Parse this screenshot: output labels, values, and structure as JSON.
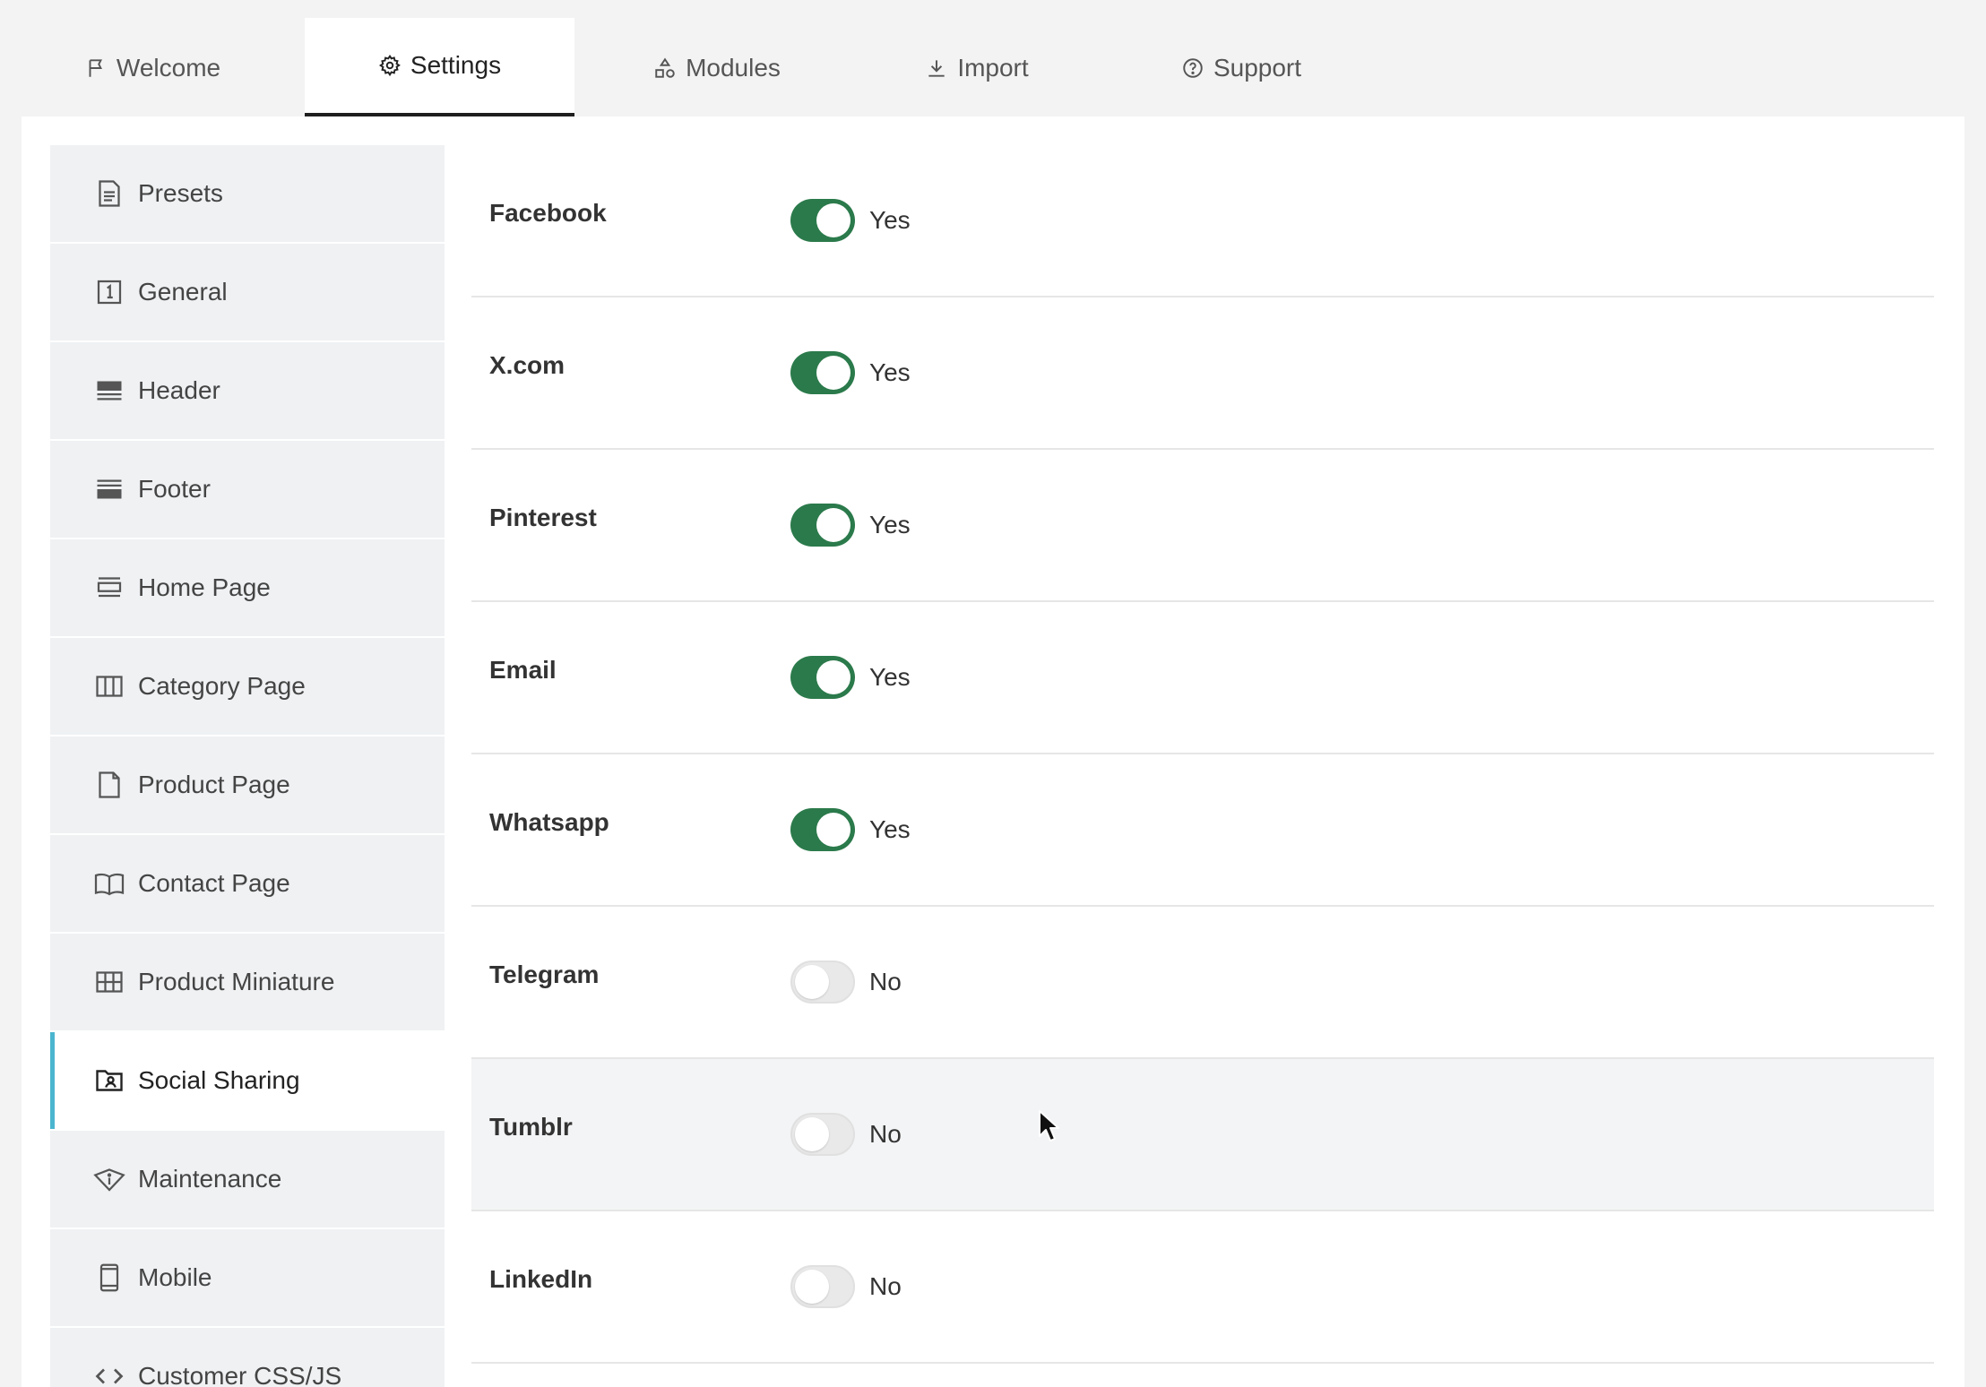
{
  "tabs": [
    {
      "label": "Welcome",
      "icon": "flag-icon"
    },
    {
      "label": "Settings",
      "icon": "gear-icon"
    },
    {
      "label": "Modules",
      "icon": "shapes-icon"
    },
    {
      "label": "Import",
      "icon": "download-icon"
    },
    {
      "label": "Support",
      "icon": "help-circle-icon"
    }
  ],
  "active_tab": "Settings",
  "sidebar": {
    "items": [
      {
        "label": "Presets",
        "icon": "document-icon"
      },
      {
        "label": "General",
        "icon": "number-one-icon"
      },
      {
        "label": "Header",
        "icon": "header-layout-icon"
      },
      {
        "label": "Footer",
        "icon": "footer-layout-icon"
      },
      {
        "label": "Home Page",
        "icon": "home-layout-icon"
      },
      {
        "label": "Category Page",
        "icon": "columns-icon"
      },
      {
        "label": "Product Page",
        "icon": "page-icon"
      },
      {
        "label": "Contact Page",
        "icon": "book-icon"
      },
      {
        "label": "Product Miniature",
        "icon": "grid-icon"
      },
      {
        "label": "Social Sharing",
        "icon": "folder-user-icon"
      },
      {
        "label": "Maintenance",
        "icon": "info-diamond-icon"
      },
      {
        "label": "Mobile",
        "icon": "phone-icon"
      },
      {
        "label": "Customer CSS/JS",
        "icon": "code-icon"
      }
    ],
    "active": "Social Sharing"
  },
  "settings": [
    {
      "label": "Facebook",
      "enabled": true,
      "state_text": "Yes"
    },
    {
      "label": "X.com",
      "enabled": true,
      "state_text": "Yes"
    },
    {
      "label": "Pinterest",
      "enabled": true,
      "state_text": "Yes"
    },
    {
      "label": "Email",
      "enabled": true,
      "state_text": "Yes"
    },
    {
      "label": "Whatsapp",
      "enabled": true,
      "state_text": "Yes"
    },
    {
      "label": "Telegram",
      "enabled": false,
      "state_text": "No"
    },
    {
      "label": "Tumblr",
      "enabled": false,
      "state_text": "No"
    },
    {
      "label": "LinkedIn",
      "enabled": false,
      "state_text": "No"
    }
  ],
  "colors": {
    "toggle_on": "#2b7a4b",
    "active_sidebar_accent": "#4bb5cf",
    "active_tab_underline": "#1f1f1f"
  }
}
